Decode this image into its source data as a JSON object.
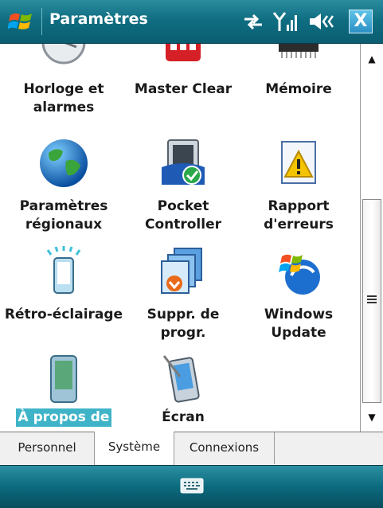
{
  "title": "Paramètres",
  "close_label": "X",
  "items": [
    {
      "label": "Horloge et alarmes",
      "icon": "clock-icon"
    },
    {
      "label": "Master Clear",
      "icon": "master-clear-icon"
    },
    {
      "label": "Mémoire",
      "icon": "memory-chip-icon"
    },
    {
      "label": "Paramètres régionaux",
      "icon": "globe-icon"
    },
    {
      "label": "Pocket Controller",
      "icon": "pocket-controller-icon"
    },
    {
      "label": "Rapport d'erreurs",
      "icon": "error-report-icon"
    },
    {
      "label": "Rétro-éclairage",
      "icon": "backlight-icon"
    },
    {
      "label": "Suppr. de progr.",
      "icon": "remove-programs-icon"
    },
    {
      "label": "Windows Update",
      "icon": "windows-update-icon"
    },
    {
      "label": "À propos de",
      "icon": "about-device-icon",
      "selected": true
    },
    {
      "label": "Écran",
      "icon": "screen-icon"
    }
  ],
  "tabs": [
    {
      "label": "Personnel",
      "active": false
    },
    {
      "label": "Système",
      "active": true
    },
    {
      "label": "Connexions",
      "active": false
    }
  ],
  "colors": {
    "titlebar": "#106e82",
    "selection": "#3fb4c8",
    "close_button": "#2a90c4"
  }
}
